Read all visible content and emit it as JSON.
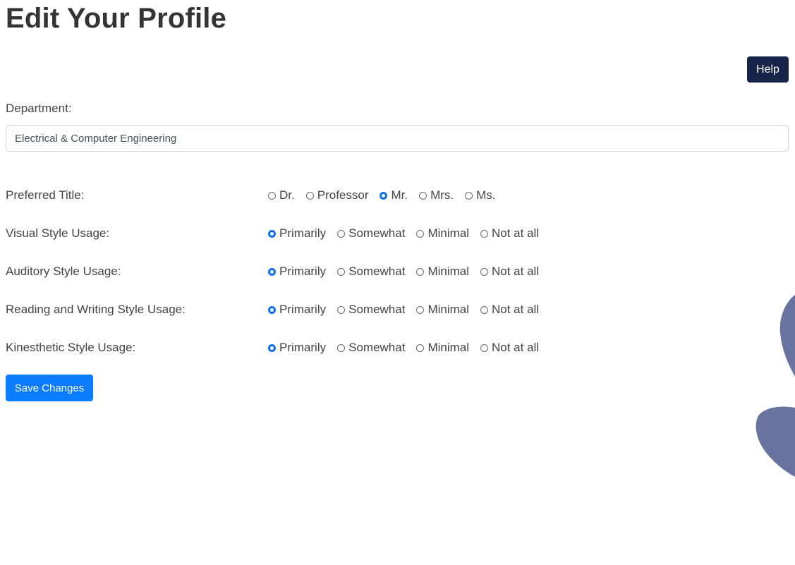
{
  "page": {
    "title": "Edit Your Profile"
  },
  "toolbar": {
    "help_label": "Help"
  },
  "department": {
    "label": "Department:",
    "value": "Electrical & Computer Engineering"
  },
  "preferred_title": {
    "label": "Preferred Title:",
    "options": [
      "Dr.",
      "Professor",
      "Mr.",
      "Mrs.",
      "Ms."
    ],
    "selected": "Mr."
  },
  "style_rows": [
    {
      "label": "Visual Style Usage:",
      "selected": "Primarily"
    },
    {
      "label": "Auditory Style Usage:",
      "selected": "Primarily"
    },
    {
      "label": "Reading and Writing Style Usage:",
      "selected": "Primarily"
    },
    {
      "label": "Kinesthetic Style Usage:",
      "selected": "Primarily"
    }
  ],
  "usage_options": [
    "Primarily",
    "Somewhat",
    "Minimal",
    "Not at all"
  ],
  "actions": {
    "save_label": "Save Changes"
  },
  "colors": {
    "help_button": "#17254a",
    "save_button": "#0a7cff",
    "radio_checked": "#0b6ff0",
    "decoration": "#68739f"
  }
}
